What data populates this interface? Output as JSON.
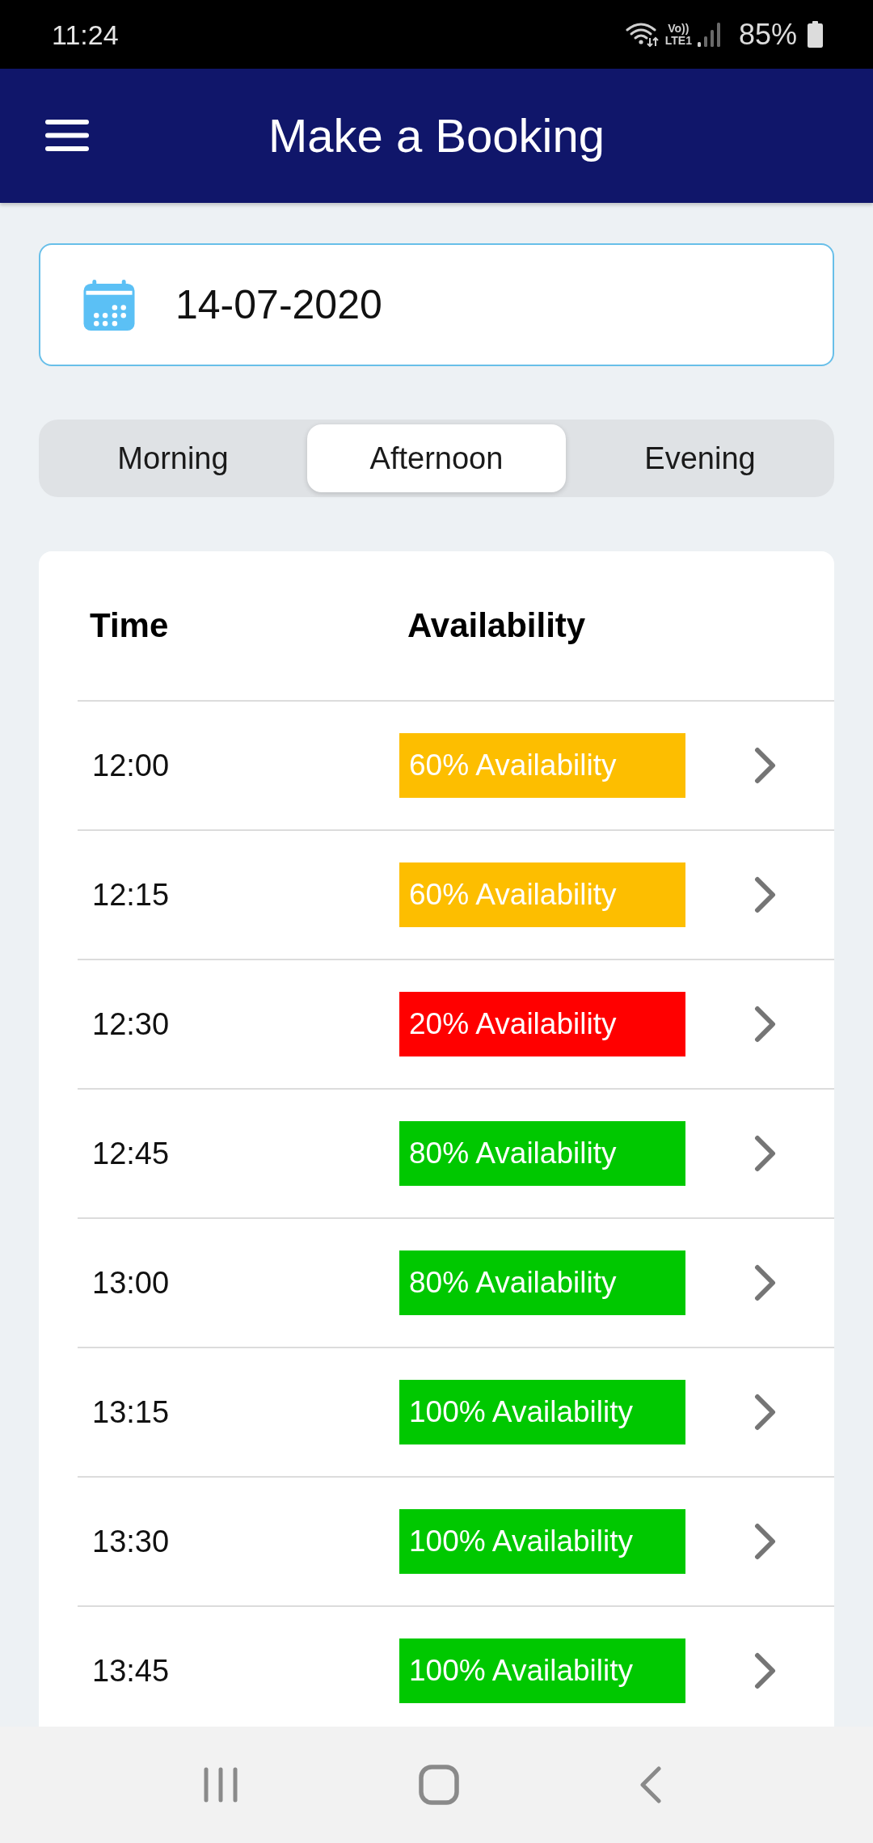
{
  "status_bar": {
    "time": "11:24",
    "network": [
      "Vo))",
      "LTE1"
    ],
    "battery": "85%"
  },
  "header": {
    "title": "Make a Booking"
  },
  "date_field": {
    "value": "14-07-2020"
  },
  "tabs": [
    {
      "label": "Morning",
      "selected": false
    },
    {
      "label": "Afternoon",
      "selected": true
    },
    {
      "label": "Evening",
      "selected": false
    }
  ],
  "table": {
    "columns": [
      "Time",
      "Availability"
    ],
    "rows": [
      {
        "time": "12:00",
        "availability": "60% Availability",
        "color": "#fdbe00"
      },
      {
        "time": "12:15",
        "availability": "60% Availability",
        "color": "#fdbe00"
      },
      {
        "time": "12:30",
        "availability": "20% Availability",
        "color": "#ff0000"
      },
      {
        "time": "12:45",
        "availability": "80% Availability",
        "color": "#00c800"
      },
      {
        "time": "13:00",
        "availability": "80% Availability",
        "color": "#00c800"
      },
      {
        "time": "13:15",
        "availability": "100% Availability",
        "color": "#00c800"
      },
      {
        "time": "13:30",
        "availability": "100% Availability",
        "color": "#00c800"
      },
      {
        "time": "13:45",
        "availability": "100% Availability",
        "color": "#00c800"
      }
    ]
  }
}
